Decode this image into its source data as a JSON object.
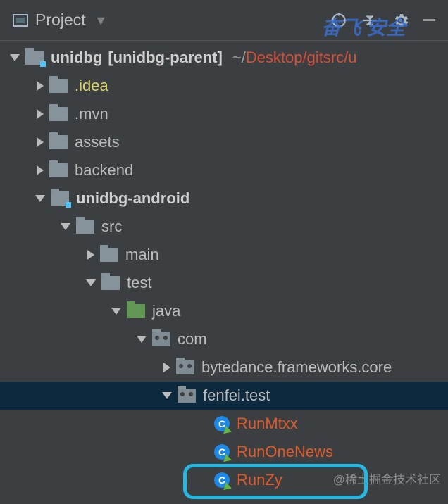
{
  "header": {
    "title": "Project"
  },
  "root": {
    "name": "unidbg",
    "bracket": "[unidbg-parent]",
    "path_tilde": "~/",
    "path_rest": "Desktop/gitsrc/u"
  },
  "nodes": {
    "idea": ".idea",
    "mvn": ".mvn",
    "assets": "assets",
    "backend": "backend",
    "android": "unidbg-android",
    "src": "src",
    "main": "main",
    "test": "test",
    "java": "java",
    "com": "com",
    "bytedance": "bytedance.frameworks.core",
    "fenfei": "fenfei.test",
    "runmtxx": "RunMtxx",
    "runonenews": "RunOneNews",
    "runzy": "RunZy"
  },
  "watermark_top": "奋飞 安全",
  "watermark_bottom": "@稀土掘金技术社区"
}
